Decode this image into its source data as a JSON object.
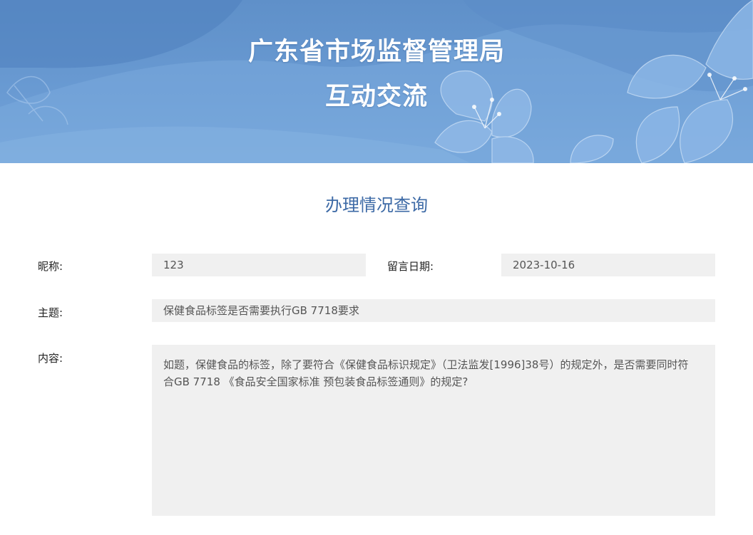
{
  "header": {
    "title_line1": "广东省市场监督管理局",
    "title_line2": "互动交流"
  },
  "section": {
    "title": "办理情况查询"
  },
  "form": {
    "nickname_label": "昵称:",
    "nickname_value": "123",
    "date_label": "留言日期:",
    "date_value": "2023-10-16",
    "subject_label": "主题:",
    "subject_value": "保健食品标签是否需要执行GB 7718要求",
    "content_label": "内容:",
    "content_value": "如题，保健食品的标签，除了要符合《保健食品标识规定》（卫法监发[1996]38号）的规定外，是否需要同时符合GB 7718 《食品安全国家标准 预包装食品标签通则》的规定?"
  },
  "colors": {
    "banner": "#6a9bd3",
    "section_title": "#3d6aa6",
    "field_bg": "#f0f0f0"
  }
}
